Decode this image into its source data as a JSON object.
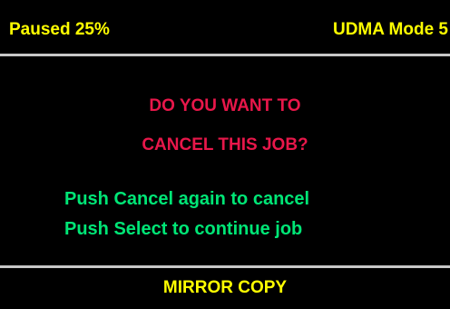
{
  "colors": {
    "background": "#000000",
    "status_text": "#ffff00",
    "prompt_text": "#e8174a",
    "instruction_text": "#00e676",
    "footer_text": "#ffff00",
    "divider": "#c8c8c8"
  },
  "status": {
    "state": "Paused 25%",
    "mode": "UDMA Mode 5"
  },
  "prompt": {
    "line1": "DO YOU WANT TO",
    "line2": "CANCEL THIS JOB?"
  },
  "instructions": {
    "cancel": "Push Cancel again to cancel",
    "continue": "Push Select to continue job"
  },
  "footer": {
    "job_type": "MIRROR COPY"
  }
}
